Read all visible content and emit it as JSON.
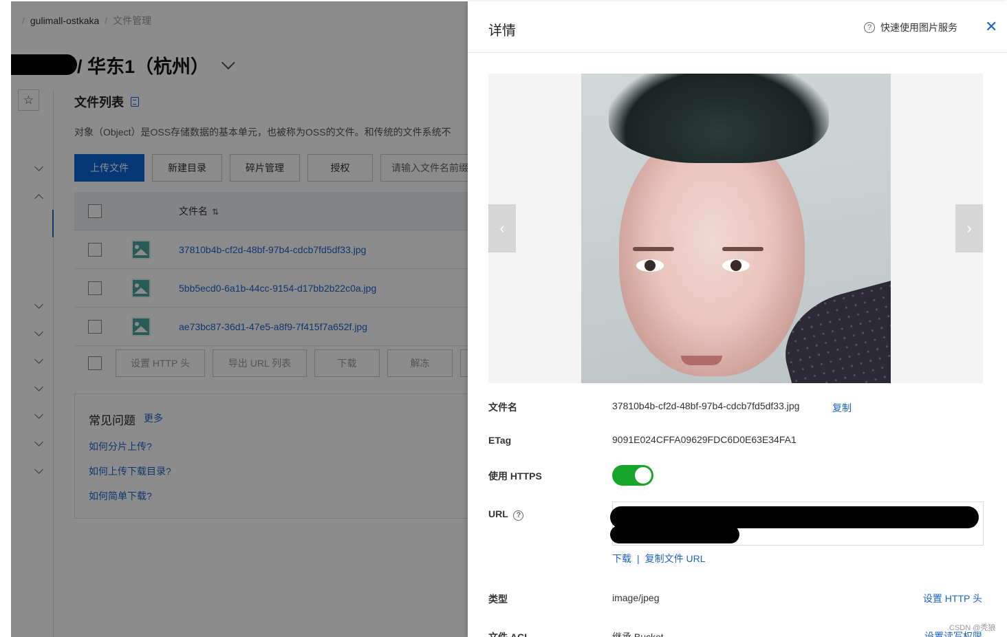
{
  "breadcrumb": {
    "bucket": "gulimall-ostkaka",
    "current": "文件管理"
  },
  "bucket_header": {
    "region": "/ 华东1（杭州）"
  },
  "files_section": {
    "title": "文件列表",
    "description": "对象（Object）是OSS存储数据的基本单元，也被称为OSS的文件。和传统的文件系统不",
    "toolbar": {
      "upload": "上传文件",
      "new_dir": "新建目录",
      "fragments": "碎片管理",
      "authorize": "授权",
      "search_placeholder": "请输入文件名前缀"
    },
    "table": {
      "column_name": "文件名",
      "rows": [
        {
          "name": "37810b4b-cf2d-48bf-97b4-cdcb7fd5df33.jpg"
        },
        {
          "name": "5bb5ecd0-6a1b-44cc-9154-d17bb2b22c0a.jpg"
        },
        {
          "name": "ae73bc87-36d1-47e5-a8f9-7f415f7a652f.jpg"
        }
      ]
    },
    "bulk_actions": {
      "set_http": "设置 HTTP 头",
      "export_url": "导出 URL 列表",
      "download": "下载",
      "unfreeze": "解冻"
    }
  },
  "faq": {
    "title": "常见问题",
    "more": "更多",
    "questions": [
      "如何分片上传?",
      "如何上传下载目录?",
      "如何简单下载?"
    ]
  },
  "drawer": {
    "title": "详情",
    "help_link": "快速使用图片服务",
    "props": {
      "filename_label": "文件名",
      "filename_value": "37810b4b-cf2d-48bf-97b4-cdcb7fd5df33.jpg",
      "copy": "复制",
      "etag_label": "ETag",
      "etag_value": "9091E024CFFA09629FDC6D0E63E34FA1",
      "https_label": "使用 HTTPS",
      "https_enabled": true,
      "url_label": "URL",
      "download": "下载",
      "copy_url": "复制文件 URL",
      "type_label": "类型",
      "type_value": "image/jpeg",
      "set_http": "设置 HTTP 头",
      "acl_label": "文件 ACL",
      "acl_value": "继承 Bucket",
      "set_acl": "设置读写权限"
    }
  },
  "watermark": "CSDN @秃狼",
  "colors": {
    "primary": "#0a64d8",
    "link": "#1c64c8",
    "toggle_on": "#15a529"
  },
  "icons": [
    "star-icon",
    "doc-icon",
    "sort-icon",
    "image-file-icon",
    "help-icon",
    "close-icon",
    "chevron-left-icon",
    "chevron-right-icon"
  ]
}
